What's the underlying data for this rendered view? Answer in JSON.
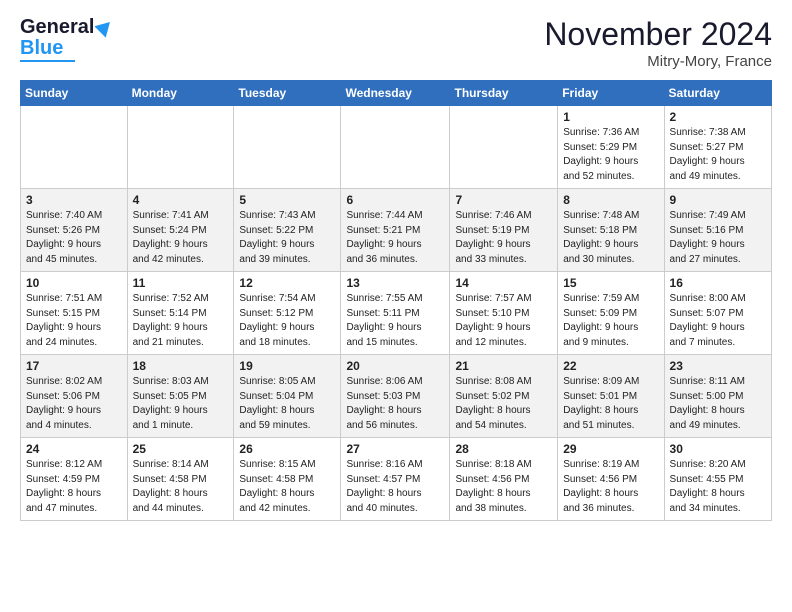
{
  "header": {
    "logo": {
      "line1": "General",
      "line2": "Blue"
    },
    "title": "November 2024",
    "location": "Mitry-Mory, France"
  },
  "weekdays": [
    "Sunday",
    "Monday",
    "Tuesday",
    "Wednesday",
    "Thursday",
    "Friday",
    "Saturday"
  ],
  "weeks": [
    [
      {
        "day": "",
        "info": ""
      },
      {
        "day": "",
        "info": ""
      },
      {
        "day": "",
        "info": ""
      },
      {
        "day": "",
        "info": ""
      },
      {
        "day": "",
        "info": ""
      },
      {
        "day": "1",
        "info": "Sunrise: 7:36 AM\nSunset: 5:29 PM\nDaylight: 9 hours\nand 52 minutes."
      },
      {
        "day": "2",
        "info": "Sunrise: 7:38 AM\nSunset: 5:27 PM\nDaylight: 9 hours\nand 49 minutes."
      }
    ],
    [
      {
        "day": "3",
        "info": "Sunrise: 7:40 AM\nSunset: 5:26 PM\nDaylight: 9 hours\nand 45 minutes."
      },
      {
        "day": "4",
        "info": "Sunrise: 7:41 AM\nSunset: 5:24 PM\nDaylight: 9 hours\nand 42 minutes."
      },
      {
        "day": "5",
        "info": "Sunrise: 7:43 AM\nSunset: 5:22 PM\nDaylight: 9 hours\nand 39 minutes."
      },
      {
        "day": "6",
        "info": "Sunrise: 7:44 AM\nSunset: 5:21 PM\nDaylight: 9 hours\nand 36 minutes."
      },
      {
        "day": "7",
        "info": "Sunrise: 7:46 AM\nSunset: 5:19 PM\nDaylight: 9 hours\nand 33 minutes."
      },
      {
        "day": "8",
        "info": "Sunrise: 7:48 AM\nSunset: 5:18 PM\nDaylight: 9 hours\nand 30 minutes."
      },
      {
        "day": "9",
        "info": "Sunrise: 7:49 AM\nSunset: 5:16 PM\nDaylight: 9 hours\nand 27 minutes."
      }
    ],
    [
      {
        "day": "10",
        "info": "Sunrise: 7:51 AM\nSunset: 5:15 PM\nDaylight: 9 hours\nand 24 minutes."
      },
      {
        "day": "11",
        "info": "Sunrise: 7:52 AM\nSunset: 5:14 PM\nDaylight: 9 hours\nand 21 minutes."
      },
      {
        "day": "12",
        "info": "Sunrise: 7:54 AM\nSunset: 5:12 PM\nDaylight: 9 hours\nand 18 minutes."
      },
      {
        "day": "13",
        "info": "Sunrise: 7:55 AM\nSunset: 5:11 PM\nDaylight: 9 hours\nand 15 minutes."
      },
      {
        "day": "14",
        "info": "Sunrise: 7:57 AM\nSunset: 5:10 PM\nDaylight: 9 hours\nand 12 minutes."
      },
      {
        "day": "15",
        "info": "Sunrise: 7:59 AM\nSunset: 5:09 PM\nDaylight: 9 hours\nand 9 minutes."
      },
      {
        "day": "16",
        "info": "Sunrise: 8:00 AM\nSunset: 5:07 PM\nDaylight: 9 hours\nand 7 minutes."
      }
    ],
    [
      {
        "day": "17",
        "info": "Sunrise: 8:02 AM\nSunset: 5:06 PM\nDaylight: 9 hours\nand 4 minutes."
      },
      {
        "day": "18",
        "info": "Sunrise: 8:03 AM\nSunset: 5:05 PM\nDaylight: 9 hours\nand 1 minute."
      },
      {
        "day": "19",
        "info": "Sunrise: 8:05 AM\nSunset: 5:04 PM\nDaylight: 8 hours\nand 59 minutes."
      },
      {
        "day": "20",
        "info": "Sunrise: 8:06 AM\nSunset: 5:03 PM\nDaylight: 8 hours\nand 56 minutes."
      },
      {
        "day": "21",
        "info": "Sunrise: 8:08 AM\nSunset: 5:02 PM\nDaylight: 8 hours\nand 54 minutes."
      },
      {
        "day": "22",
        "info": "Sunrise: 8:09 AM\nSunset: 5:01 PM\nDaylight: 8 hours\nand 51 minutes."
      },
      {
        "day": "23",
        "info": "Sunrise: 8:11 AM\nSunset: 5:00 PM\nDaylight: 8 hours\nand 49 minutes."
      }
    ],
    [
      {
        "day": "24",
        "info": "Sunrise: 8:12 AM\nSunset: 4:59 PM\nDaylight: 8 hours\nand 47 minutes."
      },
      {
        "day": "25",
        "info": "Sunrise: 8:14 AM\nSunset: 4:58 PM\nDaylight: 8 hours\nand 44 minutes."
      },
      {
        "day": "26",
        "info": "Sunrise: 8:15 AM\nSunset: 4:58 PM\nDaylight: 8 hours\nand 42 minutes."
      },
      {
        "day": "27",
        "info": "Sunrise: 8:16 AM\nSunset: 4:57 PM\nDaylight: 8 hours\nand 40 minutes."
      },
      {
        "day": "28",
        "info": "Sunrise: 8:18 AM\nSunset: 4:56 PM\nDaylight: 8 hours\nand 38 minutes."
      },
      {
        "day": "29",
        "info": "Sunrise: 8:19 AM\nSunset: 4:56 PM\nDaylight: 8 hours\nand 36 minutes."
      },
      {
        "day": "30",
        "info": "Sunrise: 8:20 AM\nSunset: 4:55 PM\nDaylight: 8 hours\nand 34 minutes."
      }
    ]
  ]
}
